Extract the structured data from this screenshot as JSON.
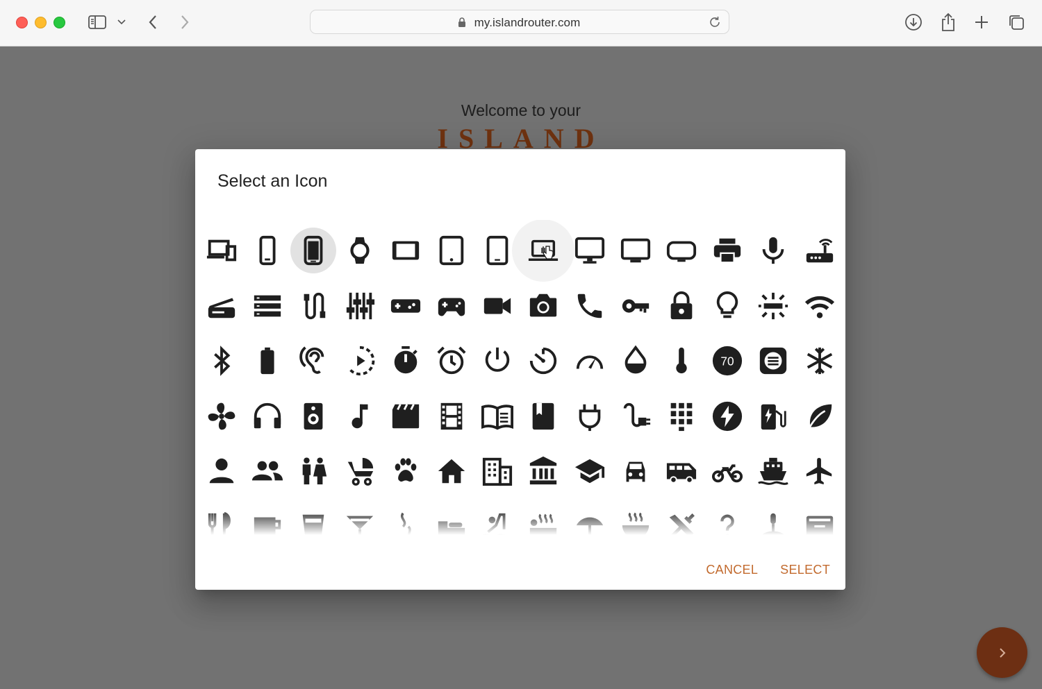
{
  "browser": {
    "url": "my.islandrouter.com"
  },
  "page": {
    "welcome": "Welcome to your",
    "brand": "ISLAND"
  },
  "dialog": {
    "title": "Select an Icon",
    "cancel_label": "CANCEL",
    "select_label": "SELECT",
    "selected_icon": "smartphone-icon",
    "accent_color": "#c26a2e",
    "icons": [
      [
        "devices-icon",
        "phone-android-icon",
        "smartphone-icon",
        "watch-icon",
        "tablet-landscape-icon",
        "tablet-android-icon",
        "tablet-mac-icon",
        "laptop-icon",
        "desktop-icon",
        "tv-icon",
        "tv-rounded-icon",
        "printer-icon",
        "microphone-icon",
        "router-icon"
      ],
      [
        "scanner-icon",
        "storage-icon",
        "cable-icon",
        "equalizer-icon",
        "gamepad-icon",
        "game-controller-icon",
        "videocam-icon",
        "camera-icon",
        "phone-icon",
        "key-icon",
        "lock-icon",
        "lightbulb-icon",
        "light-fixture-icon",
        "wifi-icon"
      ],
      [
        "bluetooth-icon",
        "battery-icon",
        "hearing-icon",
        "slow-motion-icon",
        "stopwatch-icon",
        "alarm-icon",
        "power-icon",
        "timer-icon",
        "speedometer-icon",
        "water-drop-icon",
        "thermometer-icon",
        "speed-limit-70-icon",
        "subject-icon",
        "snowflake-icon"
      ],
      [
        "fan-icon",
        "headphones-icon",
        "speaker-icon",
        "music-note-icon",
        "movie-clapper-icon",
        "film-strip-icon",
        "menu-book-icon",
        "book-icon",
        "power-plug-icon",
        "electrical-plug-icon",
        "keypad-icon",
        "flash-icon",
        "ev-station-icon",
        "leaf-icon"
      ],
      [
        "person-icon",
        "people-icon",
        "family-icon",
        "stroller-icon",
        "paw-icon",
        "home-icon",
        "office-building-icon",
        "bank-icon",
        "school-icon",
        "car-icon",
        "van-icon",
        "motorcycle-icon",
        "ferry-icon",
        "airplane-icon"
      ],
      [
        "restaurant-icon",
        "coffee-icon",
        "cup-icon",
        "cocktail-icon",
        "smoking-icon",
        "bed-icon",
        "pool-icon",
        "hot-tub-icon",
        "beach-icon",
        "ramen-icon",
        "tools-icon",
        "help-icon",
        "spa-icon",
        "kitchen-icon"
      ]
    ]
  }
}
